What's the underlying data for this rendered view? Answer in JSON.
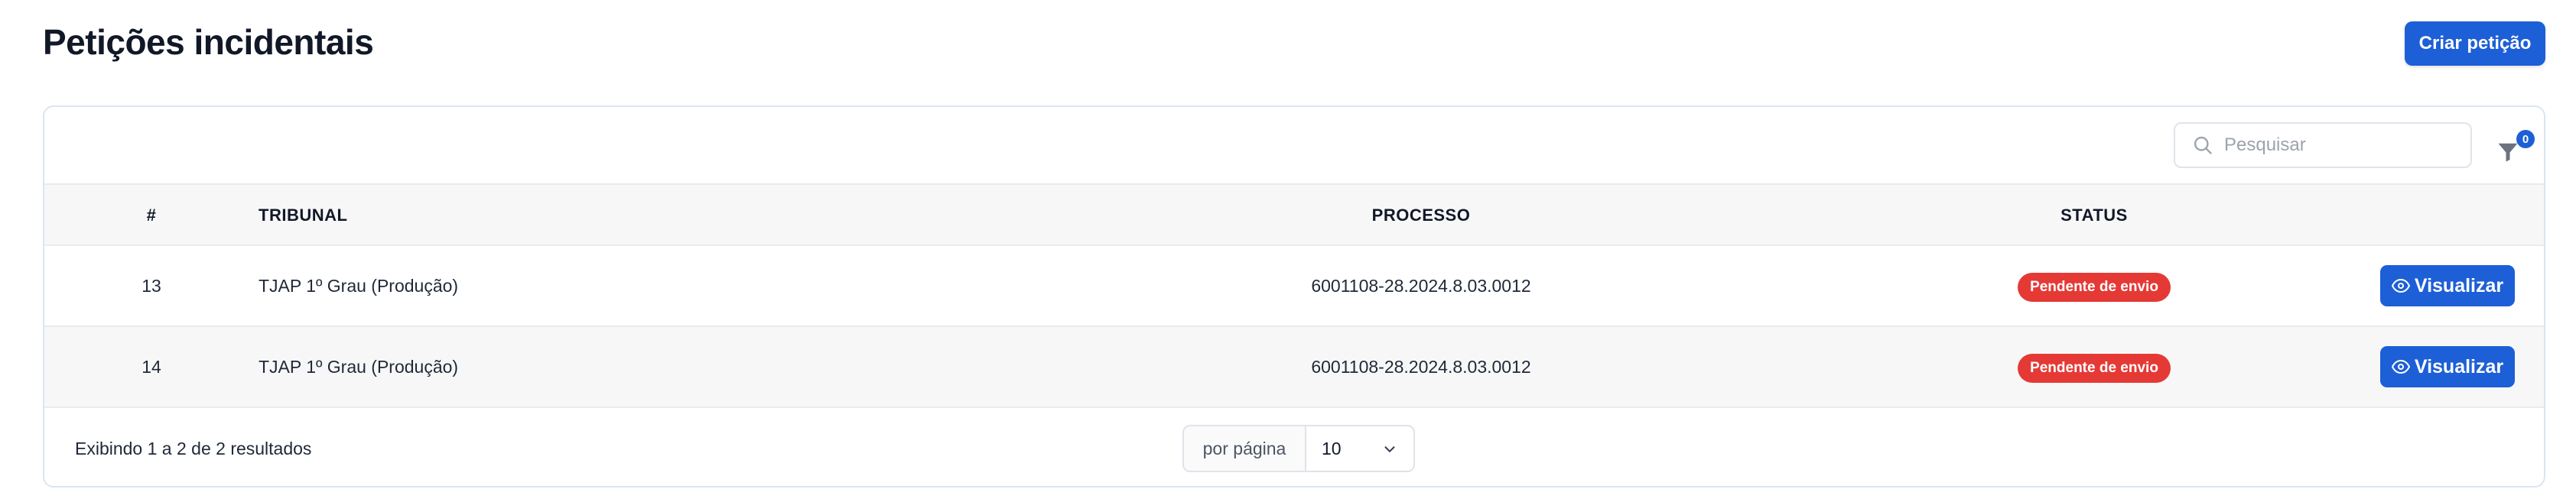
{
  "header": {
    "title": "Petições incidentais",
    "create_button": "Criar petição"
  },
  "toolbar": {
    "search_placeholder": "Pesquisar",
    "filter_count": "0"
  },
  "table": {
    "columns": [
      "#",
      "TRIBUNAL",
      "PROCESSO",
      "STATUS"
    ],
    "rows": [
      {
        "number": "13",
        "tribunal": "TJAP 1º Grau (Produção)",
        "processo": "6001108-28.2024.8.03.0012",
        "status": "Pendente de envio",
        "action": "Visualizar"
      },
      {
        "number": "14",
        "tribunal": "TJAP 1º Grau (Produção)",
        "processo": "6001108-28.2024.8.03.0012",
        "status": "Pendente de envio",
        "action": "Visualizar"
      }
    ]
  },
  "footer": {
    "results_text": "Exibindo 1 a 2 de 2 resultados",
    "per_page_label": "por página",
    "per_page_value": "10"
  },
  "colors": {
    "primary": "#1d5fd6",
    "status_pending": "#e53935",
    "header_bg": "#f7f7f8"
  },
  "icons": {
    "search": "search-icon",
    "filter": "filter-icon",
    "view": "eye-icon",
    "dropdown": "chevron-down-icon"
  }
}
